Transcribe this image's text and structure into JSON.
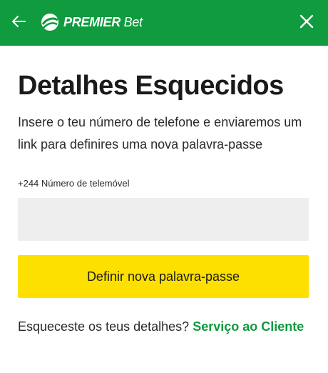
{
  "header": {
    "logo_premier": "PREMIER",
    "logo_bet": "Bet",
    "brand_color": "#0f9b3e"
  },
  "page": {
    "title": "Detalhes Esquecidos",
    "description": "Insere o teu número de telefone e enviaremos um link para definires uma nova palavra-passe"
  },
  "form": {
    "phone_label": "+244 Número de telemóvel",
    "phone_value": "",
    "phone_placeholder": "",
    "submit_label": "Definir nova palavra-passe",
    "submit_color": "#fde000"
  },
  "footer": {
    "question": "Esqueceste os teus detalhes?",
    "link_label": "Serviço ao Cliente"
  },
  "icons": {
    "back": "arrow-left-icon",
    "close": "close-icon",
    "logo": "soccer-ball-icon"
  }
}
